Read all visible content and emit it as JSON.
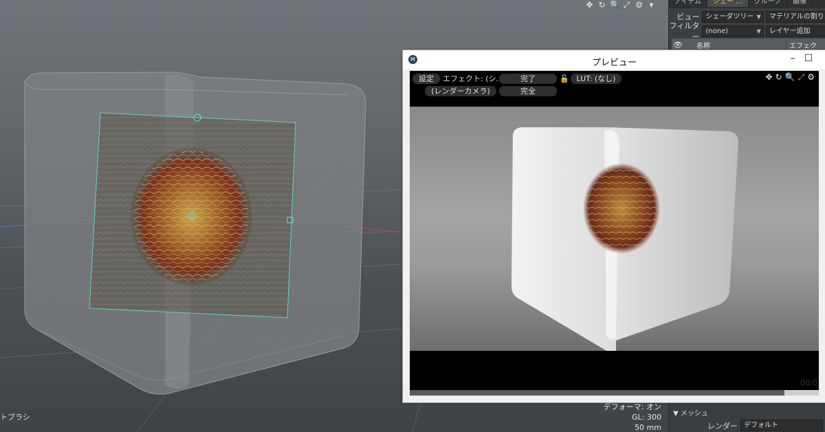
{
  "viewport": {
    "tool_icons": [
      "✥",
      "↻",
      "🔍",
      "⤢",
      "⚙",
      "▾"
    ],
    "tool_icon_names": [
      "move-view-icon",
      "rotate-view-icon",
      "zoom-view-icon",
      "maximize-icon",
      "settings-icon",
      "dropdown-icon"
    ],
    "tool_label": "トブラシ",
    "info": {
      "deformer": "デフォーマ: オン",
      "gl": "GL: 300",
      "lens": "50 mm"
    }
  },
  "panel": {
    "tabs": [
      "アイテム",
      "シェー ...",
      "グループ",
      "画像"
    ],
    "view_label": "ビュー",
    "view_value": "シェーダツリー",
    "material_button": "マテリアルの割り当",
    "filter_label": "フィルター",
    "filter_value": "(none)",
    "layer_button": "レイヤー追加",
    "name_header": "名称",
    "effect_header": "エフェク",
    "section": "メッシュ",
    "render_label": "レンダー",
    "render_value": "デフォルト"
  },
  "preview": {
    "title": "プレビュー",
    "minimize": "–",
    "maximize": "☐",
    "settings": "設定",
    "effect": "エフェクト: (シ...",
    "done": "完了",
    "lut": "LUT: (なし)",
    "camera": "(レンダーカメラ)",
    "complete": "完全",
    "timecode": "00:0"
  },
  "colors": {
    "accent": "#f0c060",
    "gizmo": "#5fd3c8"
  }
}
